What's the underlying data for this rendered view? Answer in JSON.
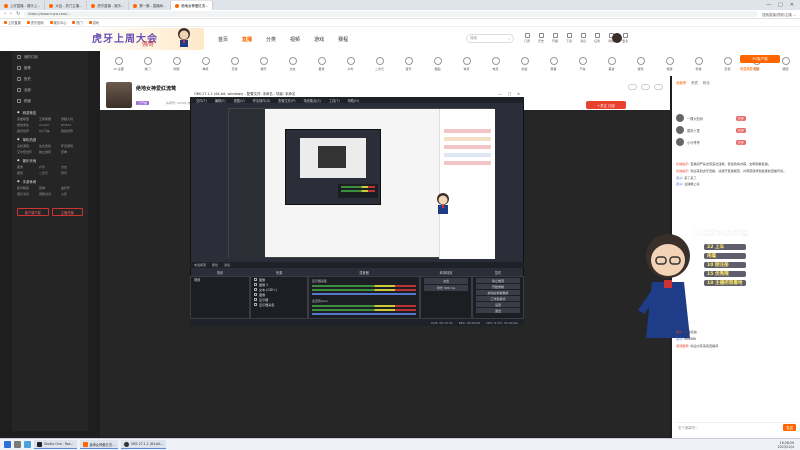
{
  "browser": {
    "tabs": [
      {
        "label": "上好直播 - 娱乐上..."
      },
      {
        "label": "大会 - 热门主播..."
      },
      {
        "label": "虎牙直播 - 娱乐..."
      },
      {
        "label": "第一篇 - 直播间..."
      },
      {
        "label": "绝地女神爱红流..."
      }
    ],
    "active_tab_index": 4,
    "url": "https://www.huya.com/...",
    "url_right": "搜索直播/视频/主播 ...",
    "window_controls": [
      "—",
      "□",
      "✕"
    ],
    "bookmarks": [
      "上好直播",
      "虎牙官网",
      "娱乐中心",
      "热门",
      "游戏"
    ]
  },
  "header": {
    "logo_text": "虎牙上周大会",
    "logo_sub": "强哥",
    "nav": [
      "首页",
      "直播",
      "分类",
      "视频",
      "游戏",
      "赛程"
    ],
    "nav_active_index": 1,
    "search_placeholder": "搜索",
    "header_icons": [
      "订阅",
      "历史",
      "开播",
      "下载",
      "消息",
      "任务",
      "商城",
      "更多"
    ]
  },
  "sidebar": {
    "top_items": [
      "我的订阅",
      "推荐",
      "历史",
      "全部",
      "频道"
    ],
    "sections": [
      {
        "title": "网游竞技",
        "items": [
          "英雄联盟",
          "王者荣耀",
          "穿越火线",
          "绝地求生",
          "CS:GO",
          "DOTA2",
          "魔兽世界",
          "QQ飞车",
          "我的世界"
        ]
      },
      {
        "title": "单机热游",
        "items": [
          "主机游戏",
          "生化危机",
          "怀旧游戏",
          "艾尔登法环",
          "独立游戏",
          "原神"
        ]
      },
      {
        "title": "娱乐天地",
        "items": [
          "星秀",
          "户外",
          "交友",
          "颜值",
          "二次元",
          "音乐"
        ]
      },
      {
        "title": "手游休闲",
        "items": [
          "和平精英",
          "原神",
          "金铲铲",
          "蛋仔派对",
          "香肠派对",
          "火影"
        ]
      }
    ],
    "bottom_buttons": [
      "客户端下载",
      "主播开播"
    ]
  },
  "categories": [
    "12 全部",
    "热门",
    "网游",
    "单机",
    "手游",
    "娱乐",
    "交友",
    "星秀",
    "户外",
    "二次元",
    "音乐",
    "舞蹈",
    "体育",
    "电竞",
    "综合",
    "赛事",
    "汽车",
    "美食",
    "游戏",
    "旅游",
    "科技",
    "影视",
    "知识",
    "萌宠"
  ],
  "pc_button": "PC客户端",
  "pc_sub": "看直播更流畅",
  "streamer": {
    "name": "绝地女神爱红流莺",
    "tag": "已开播",
    "meta": "房间号: 12345  热度: 2.1万",
    "follow_label": "+关注  订阅",
    "icons": [
      "分享",
      "举报",
      "更多"
    ]
  },
  "obs": {
    "title": "OBS 27.1.1 (64-bit, windows) - 配置文件: 未命名 - 场景: 未命名",
    "menu": [
      "文件(F)",
      "编辑(E)",
      "视图(V)",
      "停靠部件(D)",
      "配置文件(P)",
      "场景集合(S)",
      "工具(T)",
      "帮助(H)"
    ],
    "panel_bar": [
      "未选择源",
      "属性",
      "滤镜"
    ],
    "headers": [
      "场景",
      "来源",
      "混音器",
      "转场特效",
      "控件"
    ],
    "scenes": [
      "场景"
    ],
    "sources": [
      "图像",
      "图像 2",
      "文本 (GDI+)",
      "图像",
      "显示器",
      "显示器采集"
    ],
    "mixer": [
      "显示器采集",
      "麦克风/Aux"
    ],
    "transition": [
      "淡出",
      "时长 300 ms"
    ],
    "controls": [
      "停止推流",
      "开始录制",
      "启动虚拟摄像机",
      "工作室模式",
      "设置",
      "退出"
    ],
    "status": [
      "LIVE: 00:12:31",
      "REC: 00:00:00",
      "CPU: 6.3%, 30.00 fps"
    ]
  },
  "chat": {
    "tabs": [
      "贡献榜",
      "贵宾",
      "粉丝"
    ],
    "active_tab_index": 0,
    "ranks": [
      {
        "name": "一棵大松树",
        "badge": "守护"
      },
      {
        "name": "春风十里",
        "badge": "守护"
      },
      {
        "name": "小马哥哥",
        "badge": "守护"
      }
    ],
    "messages": [
      {
        "user": "系统提示",
        "text": "直播间严禁出现违法违规、低俗色情内容，文明观看直播。"
      },
      {
        "user": "系统提示",
        "text": "欢迎来到虎牙直播，请遵守直播规范，共同营造绿色健康的直播环境。"
      },
      {
        "user": "观众",
        "text": "来了来了"
      },
      {
        "user": "观众",
        "text": "主播晚上好"
      }
    ],
    "banner": "喜欢主播的点点关注",
    "float_messages": [
      "22 上车",
      "闲着",
      "10 刚注册",
      "15 优秀哦",
      "10 主播把我看哈"
    ],
    "bottom_messages": [
      {
        "user": "观众",
        "text": "主播加油"
      },
      {
        "user": "观众",
        "text": "666666"
      },
      {
        "user": "游戏昵称",
        "text": "欢迎大家来到直播间"
      }
    ],
    "input_placeholder": "发个弹幕吧~",
    "send_label": "发送"
  },
  "taskbar": {
    "apps": [
      "Studio One - Ros...",
      "鑫坤女神爱红流...",
      "OBS 27.1.1 (64-bit..."
    ],
    "time": "16:28:59",
    "date": "2023/12/4"
  }
}
